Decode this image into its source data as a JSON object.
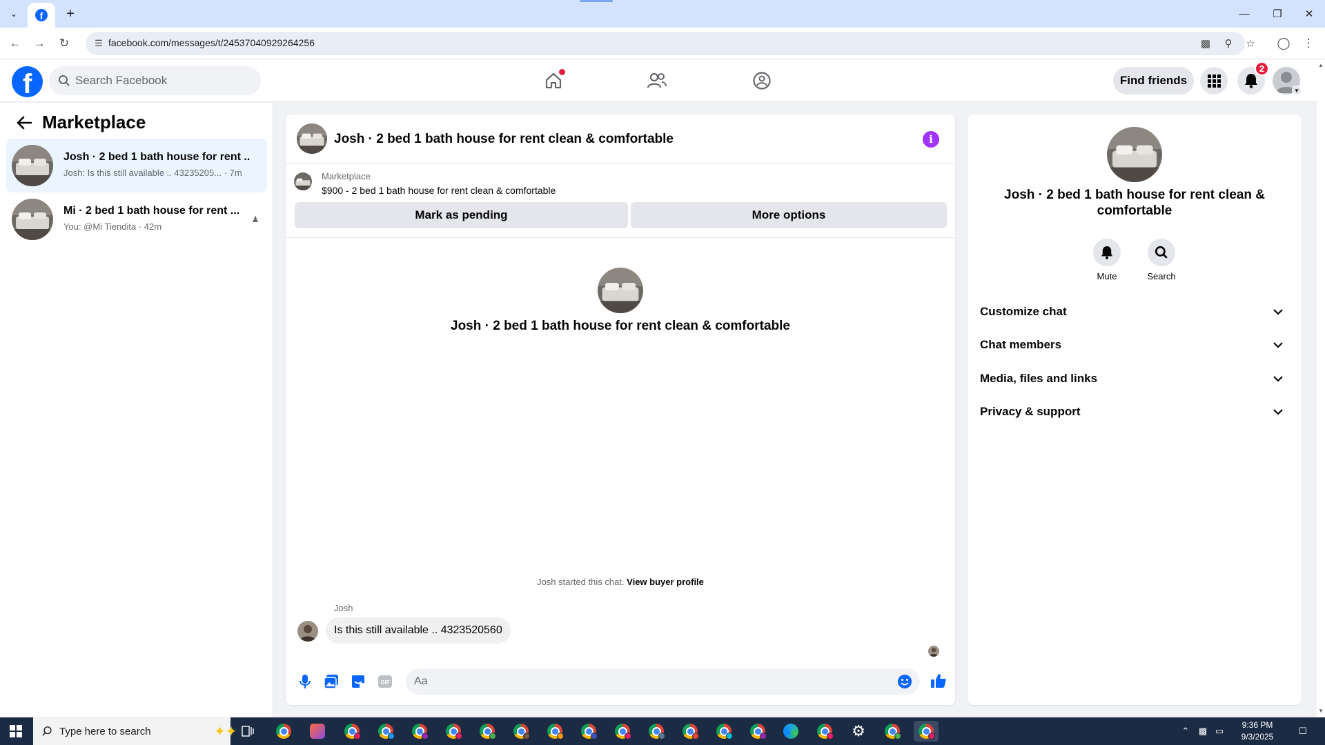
{
  "browser": {
    "url": "facebook.com/messages/t/24537040929264256"
  },
  "header": {
    "search_placeholder": "Search Facebook",
    "find_friends_label": "Find friends",
    "notification_count": "2"
  },
  "sidebar": {
    "title": "Marketplace",
    "chats": [
      {
        "name": "Josh · 2 bed 1 bath house for rent ...",
        "preview": "Josh: Is this still available .. 43235205...",
        "time": "7m",
        "active": true
      },
      {
        "name": "Mi · 2 bed 1 bath house for rent ...",
        "preview": "You: @Mi Tiendita",
        "time": "42m",
        "active": false
      }
    ]
  },
  "conversation": {
    "title": "Josh · 2 bed 1 bath house for rent clean & comfortable",
    "listing_label": "Marketplace",
    "listing_price": "$900 - 2 bed 1 bath house for rent clean & comfortable",
    "mark_pending_label": "Mark as pending",
    "more_options_label": "More options",
    "center_name": "Josh · 2 bed 1 bath house for rent clean & comfortable",
    "started_text": "Josh started this chat.",
    "view_profile_label": "View buyer profile",
    "sender_name": "Josh",
    "message_text": "Is this still available .. 4323520560",
    "composer_placeholder": "Aa"
  },
  "info_panel": {
    "name": "Josh · 2 bed 1 bath house for rent clean & comfortable",
    "mute_label": "Mute",
    "search_label": "Search",
    "sections": [
      "Customize chat",
      "Chat members",
      "Media, files and links",
      "Privacy & support"
    ]
  },
  "taskbar": {
    "search_placeholder": "Type here to search",
    "time": "9:36 PM",
    "date": "9/3/2025"
  },
  "colors": {
    "facebook_blue": "#0866ff",
    "active_chat_bg": "#ebf5ff",
    "info_purple": "#a033ff",
    "badge_red": "#e41e3f",
    "taskbar": "#1c2b44"
  }
}
